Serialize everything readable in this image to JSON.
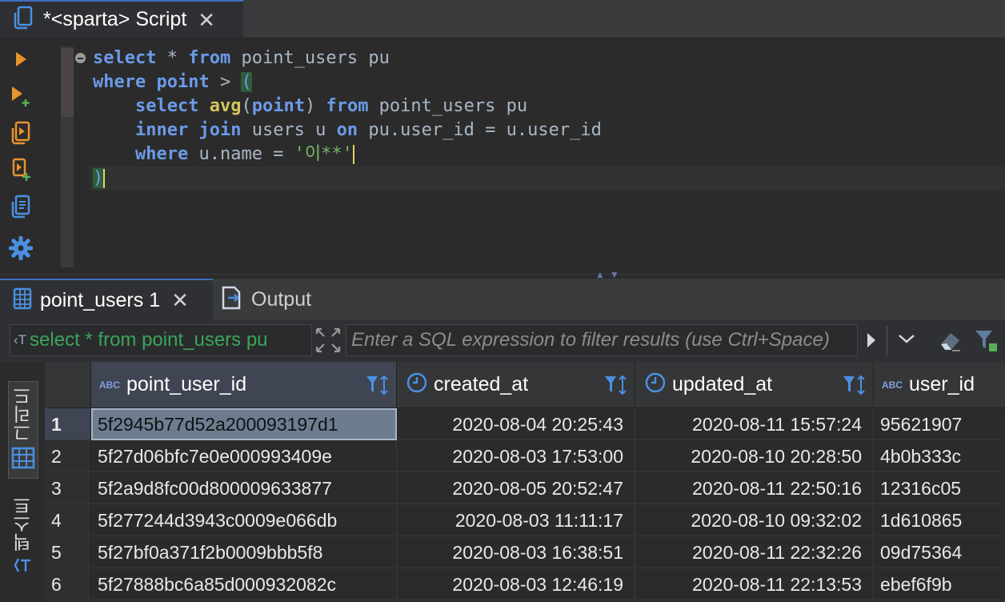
{
  "editor_tab": {
    "title": "*<sparta> Script",
    "close": "✕"
  },
  "sql_lines": {
    "l1": {
      "k1": "select",
      "t1": " * ",
      "k2": "from",
      "t2": " point_users pu"
    },
    "l2": {
      "k1": "where",
      "t1": " ",
      "k2": "point",
      "t2": " > ",
      "p": "("
    },
    "l3": {
      "indent": "    ",
      "k1": "select",
      "t1": " ",
      "f": "avg",
      "t2": "(",
      "k2": "point",
      "t3": ") ",
      "k3": "from",
      "t4": " point_users pu"
    },
    "l4": {
      "indent": "    ",
      "k1": "inner",
      "t1": " ",
      "k2": "join",
      "t2": " users u ",
      "k3": "on",
      "t3": " pu.user_id = u.user_id"
    },
    "l5": {
      "indent": "    ",
      "k1": "where",
      "t1": " u.name = ",
      "s": "'이**'"
    },
    "l6": {
      "p": ")"
    }
  },
  "result_tabs": [
    {
      "label": "point_users 1",
      "close": "✕"
    },
    {
      "label": "Output"
    }
  ],
  "filter": {
    "query_chip": "select * from point_users pu",
    "placeholder": "Enter a SQL expression to filter results (use Ctrl+Space)"
  },
  "side_tabs": {
    "grid": "그리드",
    "text": "텍스트"
  },
  "table": {
    "columns": [
      {
        "type": "ABC",
        "label": "point_user_id"
      },
      {
        "type": "clock",
        "label": "created_at"
      },
      {
        "type": "clock",
        "label": "updated_at"
      },
      {
        "type": "ABC",
        "label": "user_id"
      }
    ],
    "rows": [
      {
        "num": "1",
        "point_user_id": "5f2945b77d52a200093197d1",
        "created_at": "2020-08-04 20:25:43",
        "updated_at": "2020-08-11 15:57:24",
        "user_id": "95621907"
      },
      {
        "num": "2",
        "point_user_id": "5f27d06bfc7e0e000993409e",
        "created_at": "2020-08-03 17:53:00",
        "updated_at": "2020-08-10 20:28:50",
        "user_id": "4b0b333c"
      },
      {
        "num": "3",
        "point_user_id": "5f2a9d8fc00d800009633877",
        "created_at": "2020-08-05 20:52:47",
        "updated_at": "2020-08-11 22:50:16",
        "user_id": "12316c05"
      },
      {
        "num": "4",
        "point_user_id": "5f277244d3943c0009e066db",
        "created_at": "2020-08-03 11:11:17",
        "updated_at": "2020-08-10 09:32:02",
        "user_id": "1d610865"
      },
      {
        "num": "5",
        "point_user_id": "5f27bf0a371f2b0009bbb5f8",
        "created_at": "2020-08-03 16:38:51",
        "updated_at": "2020-08-11 22:32:26",
        "user_id": "09d75364"
      },
      {
        "num": "6",
        "point_user_id": "5f27888bc6a85d000932082c",
        "created_at": "2020-08-03 12:46:19",
        "updated_at": "2020-08-11 22:13:53",
        "user_id": "ebef6f9b"
      }
    ]
  },
  "colors": {
    "accent": "#3d6fbf",
    "keyword": "#6b9be8",
    "function": "#d1c660",
    "string": "#78b56a",
    "tool_orange": "#e8932e"
  }
}
